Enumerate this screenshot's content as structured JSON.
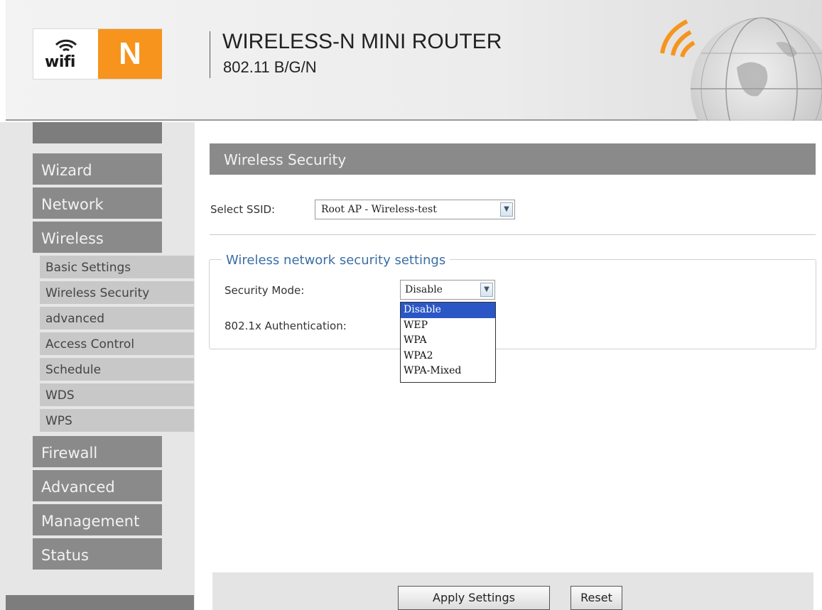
{
  "header": {
    "logo_wifi_text": "wifi",
    "logo_n_text": "N",
    "title": "WIRELESS-N MINI ROUTER",
    "subtitle": "802.11 B/G/N",
    "colors": {
      "logo_orange": "#f7941d",
      "nav_gray": "#8a8a8a",
      "accent_blue": "#3b6ea5"
    }
  },
  "sidebar": {
    "main_items_top": [
      "Wizard",
      "Network",
      "Wireless"
    ],
    "wireless_sub_items": [
      "Basic Settings",
      "Wireless Security",
      "advanced",
      "Access Control",
      "Schedule",
      "WDS",
      "WPS"
    ],
    "main_items_bottom": [
      "Firewall",
      "Advanced",
      "Management",
      "Status"
    ]
  },
  "main": {
    "section_title": "Wireless Security",
    "ssid_label": "Select SSID:",
    "ssid_value": "Root AP - Wireless-test",
    "legend": "Wireless network security settings",
    "security_mode_label": "Security Mode:",
    "security_mode_value": "Disable",
    "auth_label": "802.1x Authentication:",
    "security_mode_options": [
      "Disable",
      "WEP",
      "WPA",
      "WPA2",
      "WPA-Mixed"
    ],
    "security_mode_highlighted": "Disable"
  },
  "footer": {
    "apply_label": "Apply Settings",
    "reset_label": "Reset"
  }
}
